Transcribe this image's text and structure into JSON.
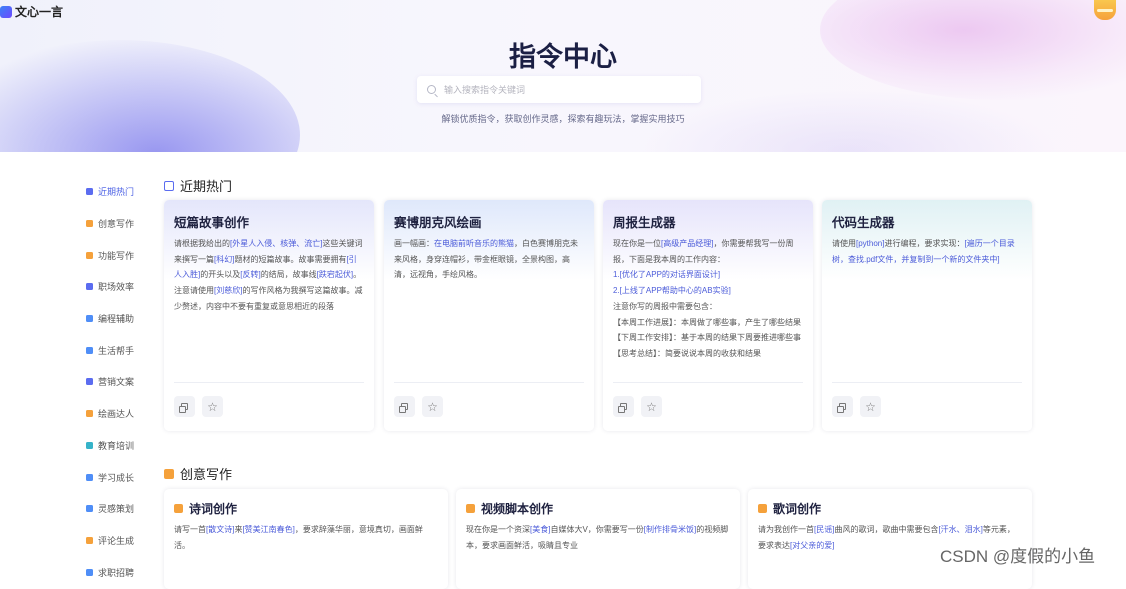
{
  "app": {
    "name": "文心一言"
  },
  "hero": {
    "title": "指令中心",
    "search_placeholder": "输入搜索指令关键词",
    "subtitle": "解锁优质指令，获取创作灵感，探索有趣玩法，掌握实用技巧"
  },
  "sidebar": {
    "items": [
      {
        "label": "近期热门",
        "icon": "hot-icon",
        "color": "#5b6cf0"
      },
      {
        "label": "创意写作",
        "icon": "pen-icon",
        "color": "#f5a13b"
      },
      {
        "label": "功能写作",
        "icon": "doc-icon",
        "color": "#f5a13b"
      },
      {
        "label": "职场效率",
        "icon": "briefcase-icon",
        "color": "#5b6cf0"
      },
      {
        "label": "编程辅助",
        "icon": "code-icon",
        "color": "#4f8ef7"
      },
      {
        "label": "生活帮手",
        "icon": "home-icon",
        "color": "#4f8ef7"
      },
      {
        "label": "营销文案",
        "icon": "megaphone-icon",
        "color": "#5b6cf0"
      },
      {
        "label": "绘画达人",
        "icon": "palette-icon",
        "color": "#f5a13b"
      },
      {
        "label": "教育培训",
        "icon": "education-icon",
        "color": "#36b3c9"
      },
      {
        "label": "学习成长",
        "icon": "book-icon",
        "color": "#4f8ef7"
      },
      {
        "label": "灵感策划",
        "icon": "bulb-icon",
        "color": "#4f8ef7"
      },
      {
        "label": "评论生成",
        "icon": "comment-icon",
        "color": "#f5a13b"
      },
      {
        "label": "求职招聘",
        "icon": "job-icon",
        "color": "#4f8ef7"
      }
    ]
  },
  "section_hot": {
    "title": "近期热门",
    "cards": [
      {
        "title": "短篇故事创作",
        "segments": [
          {
            "t": "请根据我给出的"
          },
          {
            "t": "[外星人入侵、核弹、流亡]",
            "h": true
          },
          {
            "t": "这些关键词来撰写一篇"
          },
          {
            "t": "[科幻]",
            "h": true
          },
          {
            "t": "题材的短篇故事。故事需要拥有"
          },
          {
            "t": "[引人入胜]",
            "h": true
          },
          {
            "t": "的开头以及"
          },
          {
            "t": "[反转]",
            "h": true
          },
          {
            "t": "的结局，故事线"
          },
          {
            "t": "[跌宕起伏]",
            "h": true
          },
          {
            "t": "。注意请使用"
          },
          {
            "t": "[刘慈欣]",
            "h": true
          },
          {
            "t": "的写作风格为我撰写这篇故事。减少赘述，内容中不要有重复或意思相近的段落"
          }
        ]
      },
      {
        "title": "赛博朋克风绘画",
        "segments": [
          {
            "t": "画一幅画："
          },
          {
            "t": "在电脑前听音乐的熊猫",
            "h": true
          },
          {
            "t": "，白色赛博朋克未来风格，身穿连帽衫，带金框眼镜，全景构图，高清，远视角，手绘风格。"
          }
        ]
      },
      {
        "title": "周报生成器",
        "segments": [
          {
            "t": "现在你是一位"
          },
          {
            "t": "[高级产品经理]",
            "h": true
          },
          {
            "t": "，你需要帮我写一份周报，下面是我本周的工作内容：\n"
          },
          {
            "t": "1.[优化了APP的对话界面设计]",
            "h": true
          },
          {
            "t": "\n"
          },
          {
            "t": "2.[上线了APP帮助中心的AB实验]",
            "h": true
          },
          {
            "t": "\n注意你写的周报中需要包含：\n【本周工作进展】：本周做了哪些事，产生了哪些结果\n【下周工作安排】：基于本周的结果下周要推进哪些事\n【思考总结】：简要说说本周的收获和结果"
          }
        ]
      },
      {
        "title": "代码生成器",
        "segments": [
          {
            "t": "请使用"
          },
          {
            "t": "[python]",
            "h": true
          },
          {
            "t": "进行编程，要求实现："
          },
          {
            "t": "[遍历一个目录树，查找.pdf文件，并复制到一个新的文件夹中]",
            "h": true
          }
        ]
      }
    ]
  },
  "section_creative": {
    "title": "创意写作",
    "cards": [
      {
        "title": "诗词创作",
        "segments": [
          {
            "t": "请写一首"
          },
          {
            "t": "[散文诗]",
            "h": true
          },
          {
            "t": "来"
          },
          {
            "t": "[赞美江南春色]",
            "h": true
          },
          {
            "t": "，要求辞藻华丽，意境真切，画面鲜活。"
          }
        ]
      },
      {
        "title": "视频脚本创作",
        "segments": [
          {
            "t": "现在你是一个资深"
          },
          {
            "t": "[美食]",
            "h": true
          },
          {
            "t": "自媒体大V，你需要写一份"
          },
          {
            "t": "[制作排骨米饭]",
            "h": true
          },
          {
            "t": "的视频脚本，要求画面鲜活，吸睛且专业"
          }
        ]
      },
      {
        "title": "歌词创作",
        "segments": [
          {
            "t": "请为我创作一首"
          },
          {
            "t": "[民谣]",
            "h": true
          },
          {
            "t": "曲风的歌词，歌曲中需要包含"
          },
          {
            "t": "[汗水、泪水]",
            "h": true
          },
          {
            "t": "等元素，要求表达"
          },
          {
            "t": "[对父亲的爱]",
            "h": true
          }
        ]
      }
    ]
  },
  "card_actions": {
    "copy_icon": "copy-icon",
    "favorite_icon": "star-icon"
  },
  "watermark": "CSDN @度假的小鱼",
  "colors": {
    "accent": "#4e63e5",
    "highlight": "#4b5bd9",
    "orange": "#f5a13b"
  }
}
